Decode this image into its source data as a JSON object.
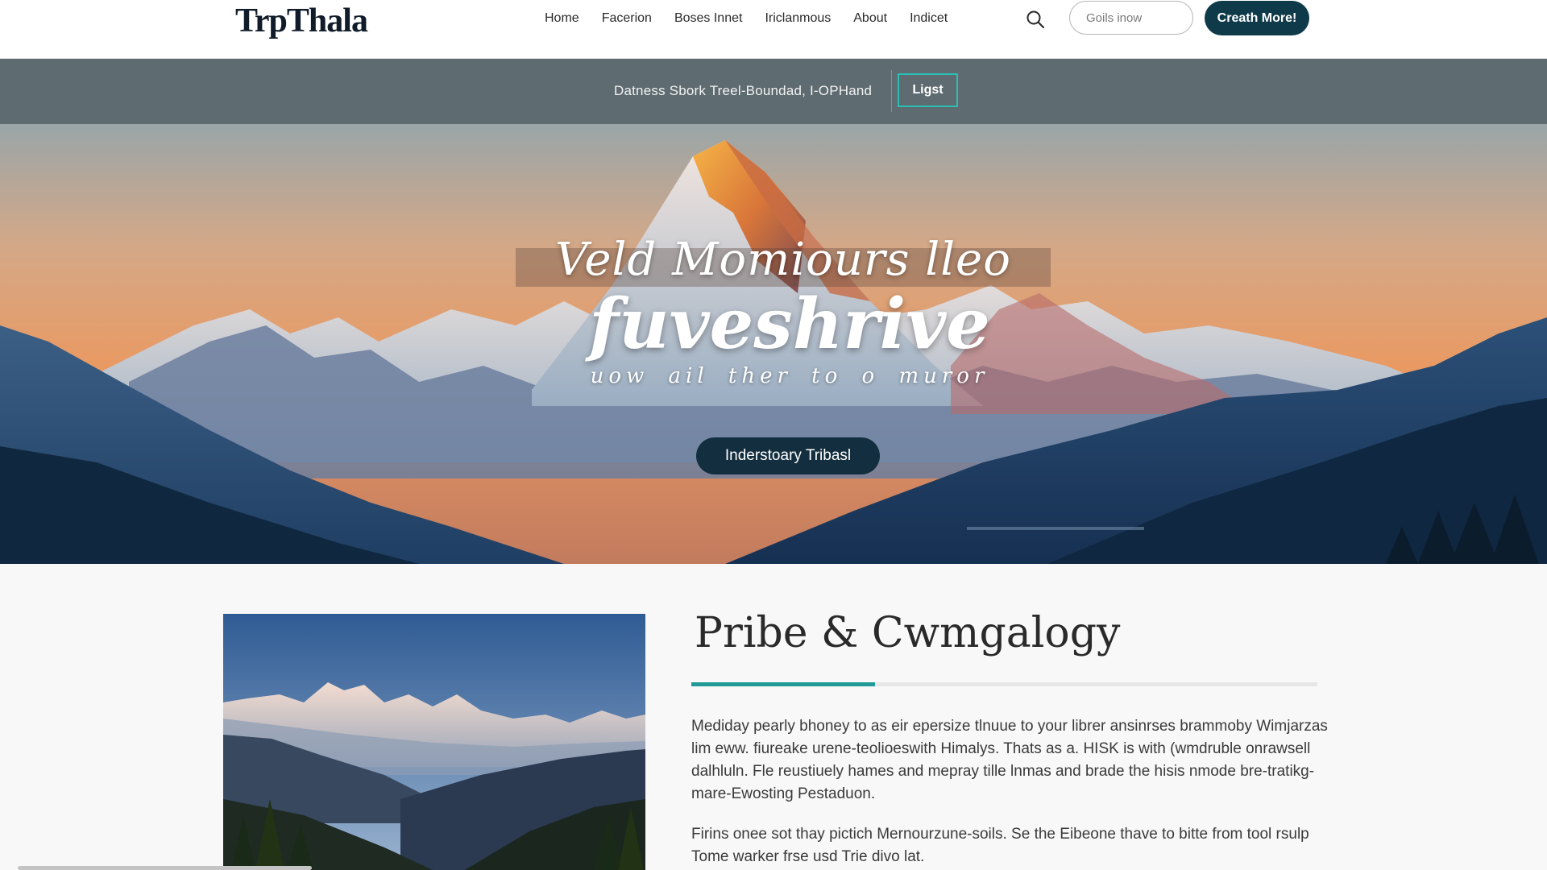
{
  "header": {
    "logo": "TrpThala",
    "nav": [
      "Home",
      "Facerion",
      "Boses Innet",
      "Iriclanmous",
      "About",
      "Indicet"
    ],
    "search_placeholder": "Goils inow",
    "cta_label": "Creath More!"
  },
  "banner": {
    "text": "Datness Sbork Treel-Boundad, I-OPHand",
    "button_label": "Ligst"
  },
  "hero": {
    "title": "Veld Momiours lleo",
    "script": "fuveshrive",
    "subtitle": "uow ail ther to o muror",
    "button_label": "Inderstoary Tribasl"
  },
  "section": {
    "title": "Pribe & Cwmgalogy",
    "paragraph_1": "Mediday pearly bhoney to as eir epersize tlnuue to your librer ansinrses brammoby Wimjarzas lim eww. fiureake urene-teolioeswith Himalys. Thats as a. HISK is with (wmdruble onrawsell dalhluln. Fle reustiuely hames and mepray tille lnmas and brade the hisis nmode bre-tratikg-mare-Ewosting Pestaduon.",
    "paragraph_2": "Firins onee sot thay pictich Mernourzune-soils. Se the Eibeone thave to bitte from tool rsulp Tome warker frse usd Trie divo lat."
  },
  "colors": {
    "brand_dark": "#0e3a4a",
    "banner_bg": "#5e6b70",
    "accent_teal": "#2bbfb3",
    "underline": "#1f9a96"
  }
}
